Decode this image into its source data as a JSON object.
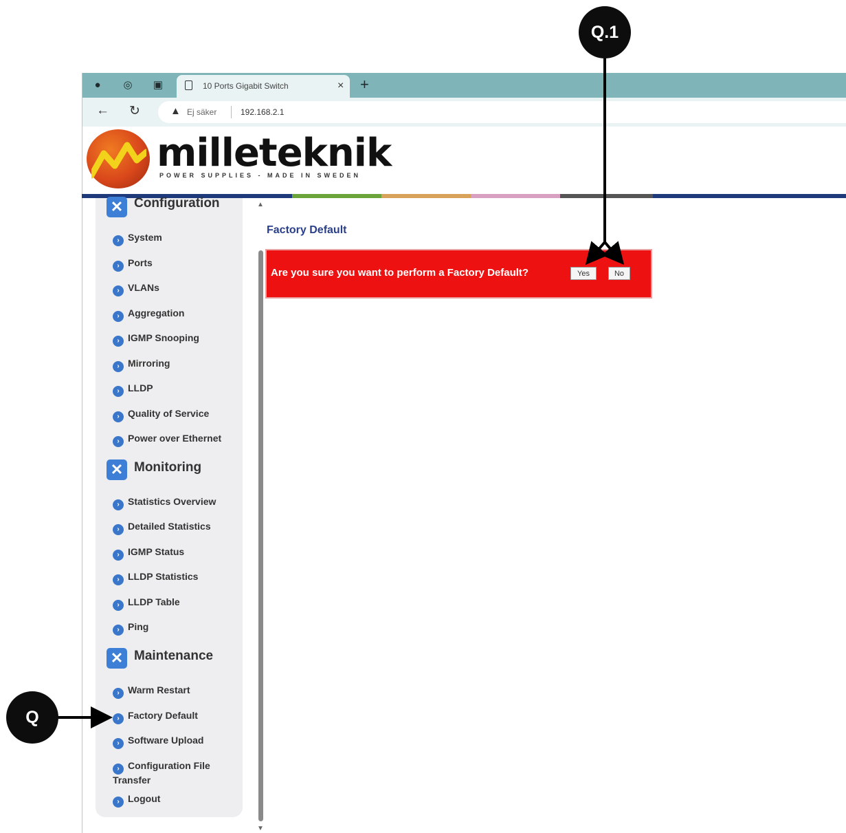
{
  "browser": {
    "tab_title": "10 Ports Gigabit Switch",
    "tab_close": "×",
    "new_tab": "+",
    "not_secure": "Ej säker",
    "url": "192.168.2.1"
  },
  "brand": {
    "name": "milleteknik",
    "tagline": "POWER SUPPLIES - MADE IN SWEDEN"
  },
  "sidebar": {
    "configuration": {
      "title": "Configuration",
      "items": [
        "System",
        "Ports",
        "VLANs",
        "Aggregation",
        "IGMP Snooping",
        "Mirroring",
        "LLDP",
        "Quality of Service",
        "Power over Ethernet"
      ]
    },
    "monitoring": {
      "title": "Monitoring",
      "items": [
        "Statistics Overview",
        "Detailed Statistics",
        "IGMP Status",
        "LLDP Statistics",
        "LLDP Table",
        "Ping"
      ]
    },
    "maintenance": {
      "title": "Maintenance",
      "items": [
        "Warm Restart",
        "Factory Default",
        "Software Upload",
        "Configuration File Transfer",
        "Logout"
      ]
    }
  },
  "main": {
    "title": "Factory Default",
    "confirm_text": "Are you sure you want to perform a Factory Default?",
    "yes_label": "Yes",
    "no_label": "No"
  },
  "annotations": {
    "q1": "Q.1",
    "q": "Q"
  },
  "colors": {
    "tab_strip": "#7fb5b8",
    "confirm_bg": "#ee1111",
    "title_blue": "#2a3f8a",
    "bullet_blue": "#3a76c9"
  }
}
